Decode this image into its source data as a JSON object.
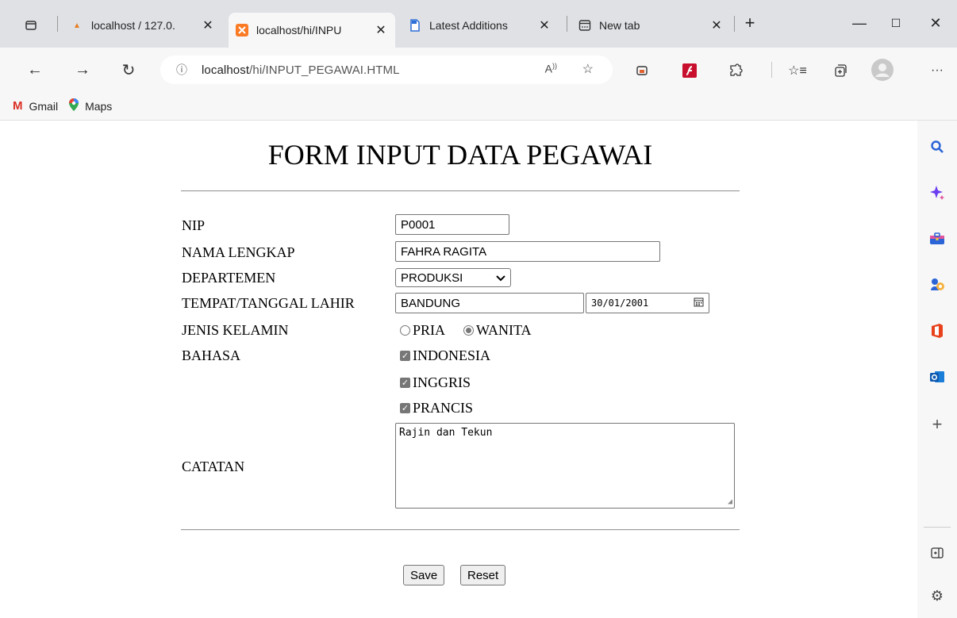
{
  "browser": {
    "tabs": [
      {
        "label": "localhost / 127.0.",
        "icon": "phpmyadmin-icon"
      },
      {
        "label": "localhost/hi/INPU",
        "icon": "xampp-icon",
        "active": true
      },
      {
        "label": "Latest Additions",
        "icon": "document-icon"
      },
      {
        "label": "New tab",
        "icon": "new-tab-page-icon"
      }
    ],
    "address": {
      "info": "ⓘ",
      "host": "localhost",
      "path": "/hi/INPUT_PEGAWAI.HTML"
    },
    "bookmarks": [
      {
        "label": "Gmail",
        "icon": "gmail-icon"
      },
      {
        "label": "Maps",
        "icon": "maps-icon"
      }
    ]
  },
  "form": {
    "title": "FORM INPUT DATA PEGAWAI",
    "nip": {
      "label": "NIP",
      "value": "P0001"
    },
    "nama": {
      "label": "NAMA LENGKAP",
      "value": "FAHRA RAGITA"
    },
    "departemen": {
      "label": "DEPARTEMEN",
      "value": "PRODUKSI"
    },
    "ttl": {
      "label": "TEMPAT/TANGGAL LAHIR",
      "place": "BANDUNG",
      "date": "30/01/2001"
    },
    "gender": {
      "label": "JENIS KELAMIN",
      "options": [
        "PRIA",
        "WANITA"
      ],
      "selected": "WANITA"
    },
    "bahasa": {
      "label": "BAHASA",
      "options": [
        "INDONESIA",
        "INGGRIS",
        "PRANCIS"
      ],
      "checked": [
        true,
        true,
        true
      ]
    },
    "catatan": {
      "label": "CATATAN",
      "value": "Rajin dan Tekun"
    },
    "save_label": "Save",
    "reset_label": "Reset"
  },
  "colors": {
    "tab_strip": "#dfe1e5",
    "toolbar": "#f7f7f7",
    "checkbox": "#767676"
  }
}
